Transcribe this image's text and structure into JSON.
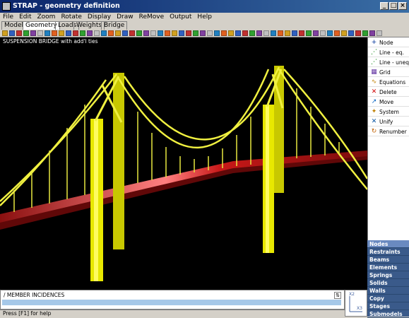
{
  "window": {
    "title": "STRAP - geometry definition"
  },
  "menu": [
    "File",
    "Edit",
    "Zoom",
    "Rotate",
    "Display",
    "Draw",
    "ReMove",
    "Output",
    "Help"
  ],
  "tabs": [
    {
      "label": "Models"
    },
    {
      "label": "Geometry",
      "active": true
    },
    {
      "label": "Loads"
    },
    {
      "label": "Weights"
    },
    {
      "label": "Bridge"
    }
  ],
  "viewport": {
    "title": "SUSPENSION BRIDGE with add'l ties"
  },
  "side_tools": [
    {
      "label": "Node",
      "icon": "+",
      "color": "#003399"
    },
    {
      "label": "Line - eq.",
      "icon": "⋰",
      "color": "#008000"
    },
    {
      "label": "Line - uneq.",
      "icon": "⋰",
      "color": "#008000"
    },
    {
      "label": "Grid",
      "icon": "▦",
      "color": "#6030a0"
    },
    {
      "label": "Equations",
      "icon": "∿",
      "color": "#c08000"
    },
    {
      "label": "Delete",
      "icon": "✕",
      "color": "#d00000"
    },
    {
      "label": "Move",
      "icon": "↗",
      "color": "#0060c0"
    },
    {
      "label": "System",
      "icon": "✦",
      "color": "#c08000"
    },
    {
      "label": "Unify",
      "icon": "✕",
      "color": "#0050a0"
    },
    {
      "label": "Renumber",
      "icon": "↻",
      "color": "#c06000"
    }
  ],
  "modes": [
    {
      "label": "Nodes",
      "active": true
    },
    {
      "label": "Restraints"
    },
    {
      "label": "Beams"
    },
    {
      "label": "Elements"
    },
    {
      "label": "Springs"
    },
    {
      "label": "Solids"
    },
    {
      "label": "Walls"
    },
    {
      "label": "Copy"
    },
    {
      "label": "Stages"
    },
    {
      "label": "Submodels"
    }
  ],
  "command": {
    "label": "/ MEMBER INCIDENCES"
  },
  "status": {
    "text": "Press [F1] for help"
  },
  "axes": {
    "x_label": "X2",
    "y_label": "X3"
  },
  "colors": {
    "deck": "#cc2020",
    "towers": "#e8e800",
    "background": "#000000",
    "titlebar": "#0a246a"
  }
}
